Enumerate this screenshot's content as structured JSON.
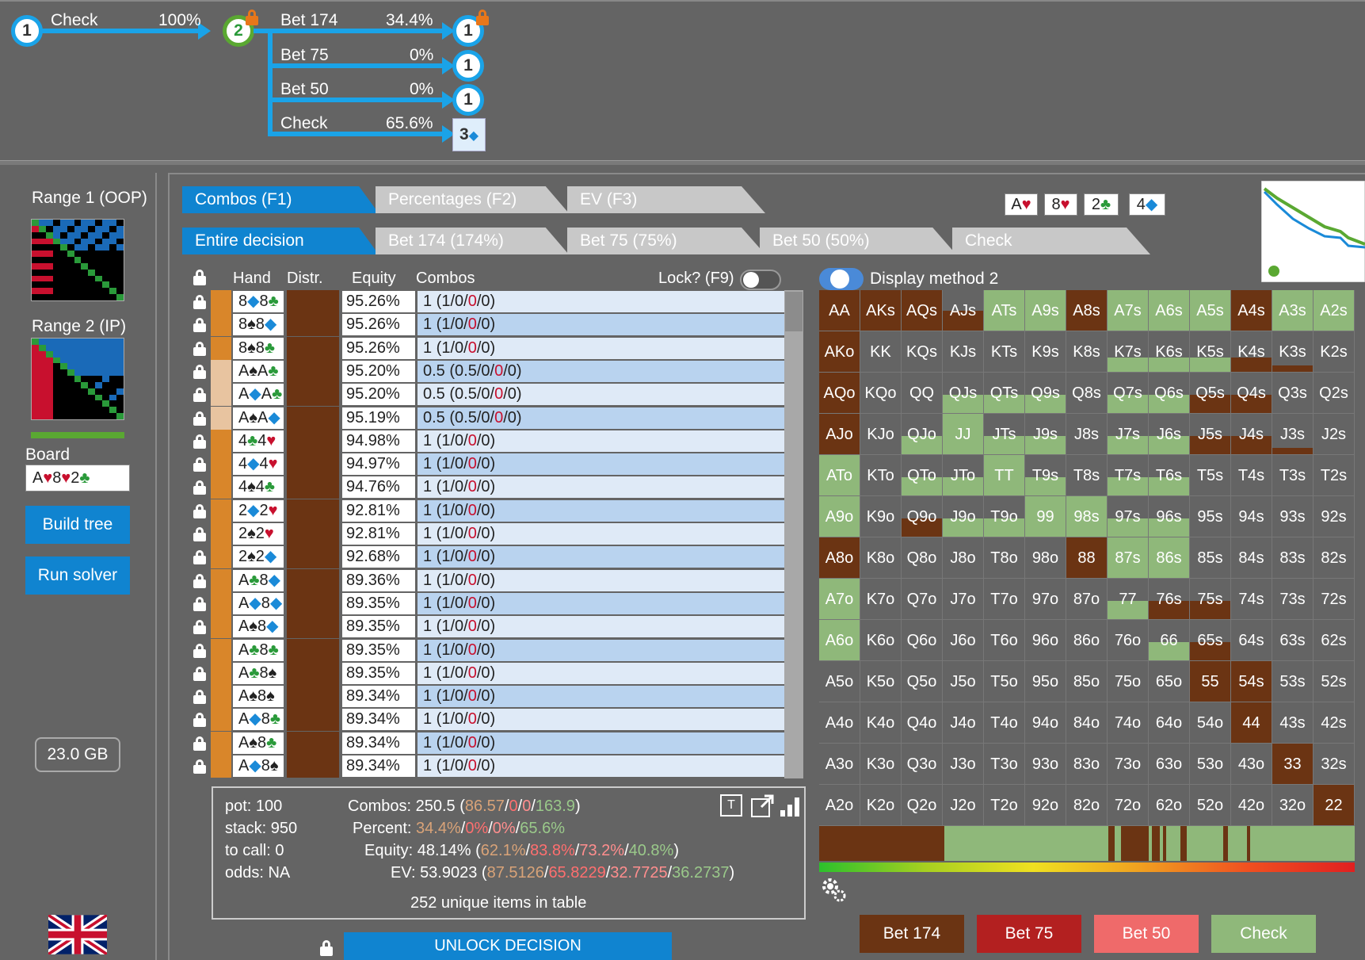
{
  "tree": {
    "root_node": "1",
    "root_action": "Check",
    "root_pct": "100%",
    "node2": "2",
    "branches": [
      {
        "label": "Bet 174",
        "pct": "34.4%",
        "node": "1"
      },
      {
        "label": "Bet 75",
        "pct": "0%",
        "node": "1"
      },
      {
        "label": "Bet 50",
        "pct": "0%",
        "node": "1"
      },
      {
        "label": "Check",
        "pct": "65.6%",
        "node": "3"
      }
    ]
  },
  "left": {
    "range1_title": "Range 1 (OOP)",
    "range2_title": "Range 2 (IP)",
    "board_label": "Board",
    "board_value": [
      "A",
      "♥",
      "8",
      "♥",
      "2",
      "♣"
    ],
    "build_tree": "Build tree",
    "run_solver": "Run solver",
    "memory": "23.0 GB"
  },
  "tabs": {
    "view": [
      "Combos (F1)",
      "Percentages (F2)",
      "EV (F3)"
    ],
    "decision": [
      "Entire decision",
      "Bet 174 (174%)",
      "Bet 75 (75%)",
      "Bet 50 (50%)",
      "Check"
    ]
  },
  "board_cards": [
    {
      "rank": "A",
      "suit": "♥",
      "color": "#c8102e"
    },
    {
      "rank": "8",
      "suit": "♥",
      "color": "#c8102e"
    },
    {
      "rank": "2",
      "suit": "♣",
      "color": "#2a9a3a"
    },
    {
      "rank": "4",
      "suit": "◆",
      "color": "#1a8ad8"
    }
  ],
  "table": {
    "headers": {
      "hand": "Hand",
      "distr": "Distr.",
      "equity": "Equity",
      "combos": "Combos",
      "lock": "Lock? (F9)"
    },
    "display_method": "Display method 2",
    "rows": [
      {
        "r1": "8",
        "s1": "◆",
        "r2": "8",
        "s2": "♣",
        "eq": "95.26%",
        "c0": "1",
        "c1": "1",
        "strip": "#d9862a"
      },
      {
        "r1": "8",
        "s1": "♠",
        "r2": "8",
        "s2": "◆",
        "eq": "95.26%",
        "c0": "1",
        "c1": "1",
        "strip": "#d9862a"
      },
      {
        "r1": "8",
        "s1": "♠",
        "r2": "8",
        "s2": "♣",
        "eq": "95.26%",
        "c0": "1",
        "c1": "1",
        "strip": "#d9862a"
      },
      {
        "r1": "A",
        "s1": "♠",
        "r2": "A",
        "s2": "♣",
        "eq": "95.20%",
        "c0": "0.5",
        "c1": "0.5",
        "strip": "#e8c4a0"
      },
      {
        "r1": "A",
        "s1": "◆",
        "r2": "A",
        "s2": "♣",
        "eq": "95.20%",
        "c0": "0.5",
        "c1": "0.5",
        "strip": "#e8c4a0"
      },
      {
        "r1": "A",
        "s1": "♠",
        "r2": "A",
        "s2": "◆",
        "eq": "95.19%",
        "c0": "0.5",
        "c1": "0.5",
        "strip": "#e8c4a0"
      },
      {
        "r1": "4",
        "s1": "♣",
        "r2": "4",
        "s2": "♥",
        "eq": "94.98%",
        "c0": "1",
        "c1": "1",
        "strip": "#d9862a"
      },
      {
        "r1": "4",
        "s1": "◆",
        "r2": "4",
        "s2": "♥",
        "eq": "94.97%",
        "c0": "1",
        "c1": "1",
        "strip": "#d9862a"
      },
      {
        "r1": "4",
        "s1": "♠",
        "r2": "4",
        "s2": "♣",
        "eq": "94.76%",
        "c0": "1",
        "c1": "1",
        "strip": "#d9862a"
      },
      {
        "r1": "2",
        "s1": "◆",
        "r2": "2",
        "s2": "♥",
        "eq": "92.81%",
        "c0": "1",
        "c1": "1",
        "strip": "#d9862a"
      },
      {
        "r1": "2",
        "s1": "♠",
        "r2": "2",
        "s2": "♥",
        "eq": "92.81%",
        "c0": "1",
        "c1": "1",
        "strip": "#d9862a"
      },
      {
        "r1": "2",
        "s1": "♠",
        "r2": "2",
        "s2": "◆",
        "eq": "92.68%",
        "c0": "1",
        "c1": "1",
        "strip": "#d9862a"
      },
      {
        "r1": "A",
        "s1": "♣",
        "r2": "8",
        "s2": "◆",
        "eq": "89.36%",
        "c0": "1",
        "c1": "1",
        "strip": "#d9862a"
      },
      {
        "r1": "A",
        "s1": "◆",
        "r2": "8",
        "s2": "◆",
        "eq": "89.35%",
        "c0": "1",
        "c1": "1",
        "strip": "#d9862a"
      },
      {
        "r1": "A",
        "s1": "♠",
        "r2": "8",
        "s2": "◆",
        "eq": "89.35%",
        "c0": "1",
        "c1": "1",
        "strip": "#d9862a"
      },
      {
        "r1": "A",
        "s1": "♣",
        "r2": "8",
        "s2": "♣",
        "eq": "89.35%",
        "c0": "1",
        "c1": "1",
        "strip": "#d9862a"
      },
      {
        "r1": "A",
        "s1": "♣",
        "r2": "8",
        "s2": "♠",
        "eq": "89.35%",
        "c0": "1",
        "c1": "1",
        "strip": "#d9862a"
      },
      {
        "r1": "A",
        "s1": "♠",
        "r2": "8",
        "s2": "♠",
        "eq": "89.34%",
        "c0": "1",
        "c1": "1",
        "strip": "#d9862a"
      },
      {
        "r1": "A",
        "s1": "◆",
        "r2": "8",
        "s2": "♣",
        "eq": "89.34%",
        "c0": "1",
        "c1": "1",
        "strip": "#d9862a"
      },
      {
        "r1": "A",
        "s1": "♠",
        "r2": "8",
        "s2": "♣",
        "eq": "89.34%",
        "c0": "1",
        "c1": "1",
        "strip": "#d9862a"
      },
      {
        "r1": "A",
        "s1": "◆",
        "r2": "8",
        "s2": "♠",
        "eq": "89.34%",
        "c0": "1",
        "c1": "1",
        "strip": "#d9862a"
      }
    ]
  },
  "info": {
    "pot": "pot: 100",
    "stack": "stack: 950",
    "to_call": "to call: 0",
    "odds": "odds: NA",
    "combos_label": "Combos:",
    "combos_total": "250.5",
    "combos_parts": [
      "86.57",
      "0",
      "0",
      "163.9"
    ],
    "percent_label": "Percent:",
    "percent_parts": [
      "34.4%",
      "0%",
      "0%",
      "65.6%"
    ],
    "equity_label": "Equity:",
    "equity_total": "48.14%",
    "equity_parts": [
      "62.1%",
      "83.8%",
      "73.2%",
      "40.8%"
    ],
    "ev_label": "EV:",
    "ev_total": "53.9023",
    "ev_parts": [
      "87.5126",
      "65.8229",
      "32.7725",
      "36.2737"
    ],
    "unique": "252 unique items in table"
  },
  "matrix": [
    [
      "AA",
      "AKs",
      "AQs",
      "AJs",
      "ATs",
      "A9s",
      "A8s",
      "A7s",
      "A6s",
      "A5s",
      "A4s",
      "A3s",
      "A2s"
    ],
    [
      "AKo",
      "KK",
      "KQs",
      "KJs",
      "KTs",
      "K9s",
      "K8s",
      "K7s",
      "K6s",
      "K5s",
      "K4s",
      "K3s",
      "K2s"
    ],
    [
      "AQo",
      "KQo",
      "QQ",
      "QJs",
      "QTs",
      "Q9s",
      "Q8s",
      "Q7s",
      "Q6s",
      "Q5s",
      "Q4s",
      "Q3s",
      "Q2s"
    ],
    [
      "AJo",
      "KJo",
      "QJo",
      "JJ",
      "JTs",
      "J9s",
      "J8s",
      "J7s",
      "J6s",
      "J5s",
      "J4s",
      "J3s",
      "J2s"
    ],
    [
      "ATo",
      "KTo",
      "QTo",
      "JTo",
      "TT",
      "T9s",
      "T8s",
      "T7s",
      "T6s",
      "T5s",
      "T4s",
      "T3s",
      "T2s"
    ],
    [
      "A9o",
      "K9o",
      "Q9o",
      "J9o",
      "T9o",
      "99",
      "98s",
      "97s",
      "96s",
      "95s",
      "94s",
      "93s",
      "92s"
    ],
    [
      "A8o",
      "K8o",
      "Q8o",
      "J8o",
      "T8o",
      "98o",
      "88",
      "87s",
      "86s",
      "85s",
      "84s",
      "83s",
      "82s"
    ],
    [
      "A7o",
      "K7o",
      "Q7o",
      "J7o",
      "T7o",
      "97o",
      "87o",
      "77",
      "76s",
      "75s",
      "74s",
      "73s",
      "72s"
    ],
    [
      "A6o",
      "K6o",
      "Q6o",
      "J6o",
      "T6o",
      "96o",
      "86o",
      "76o",
      "66",
      "65s",
      "64s",
      "63s",
      "62s"
    ],
    [
      "A5o",
      "K5o",
      "Q5o",
      "J5o",
      "T5o",
      "95o",
      "85o",
      "75o",
      "65o",
      "55",
      "54s",
      "53s",
      "52s"
    ],
    [
      "A4o",
      "K4o",
      "Q4o",
      "J4o",
      "T4o",
      "94o",
      "84o",
      "74o",
      "64o",
      "54o",
      "44",
      "43s",
      "42s"
    ],
    [
      "A3o",
      "K3o",
      "Q3o",
      "J3o",
      "T3o",
      "93o",
      "83o",
      "73o",
      "63o",
      "53o",
      "43o",
      "33",
      "32s"
    ],
    [
      "A2o",
      "K2o",
      "Q2o",
      "J2o",
      "T2o",
      "92o",
      "82o",
      "72o",
      "62o",
      "52o",
      "42o",
      "32o",
      "22"
    ]
  ],
  "matrix_fill": [
    [
      [
        "b",
        1
      ],
      [
        "b",
        1
      ],
      [
        "b",
        1
      ],
      [
        "b",
        0.5
      ],
      [
        "g",
        1
      ],
      [
        "g",
        1
      ],
      [
        "b",
        1
      ],
      [
        "g",
        1
      ],
      [
        "g",
        1
      ],
      [
        "g",
        1
      ],
      [
        "b",
        1
      ],
      [
        "g",
        1
      ],
      [
        "g",
        1
      ]
    ],
    [
      [
        "b",
        1
      ],
      [
        "n",
        0
      ],
      [
        "n",
        0
      ],
      [
        "n",
        0
      ],
      [
        "n",
        0
      ],
      [
        "n",
        0
      ],
      [
        "n",
        0
      ],
      [
        "g",
        0.35
      ],
      [
        "g",
        0.35
      ],
      [
        "g",
        0.35
      ],
      [
        "b",
        0.35
      ],
      [
        "b",
        0.15
      ],
      [
        "n",
        0
      ]
    ],
    [
      [
        "b",
        1
      ],
      [
        "n",
        0
      ],
      [
        "n",
        0
      ],
      [
        "g",
        0.45
      ],
      [
        "g",
        0.45
      ],
      [
        "g",
        0.45
      ],
      [
        "n",
        0
      ],
      [
        "g",
        0.45
      ],
      [
        "g",
        0.45
      ],
      [
        "b",
        0.45
      ],
      [
        "b",
        0.45
      ],
      [
        "n",
        0
      ],
      [
        "n",
        0
      ]
    ],
    [
      [
        "b",
        1
      ],
      [
        "n",
        0
      ],
      [
        "g",
        0.45
      ],
      [
        "g",
        1
      ],
      [
        "g",
        0.45
      ],
      [
        "g",
        0.45
      ],
      [
        "n",
        0
      ],
      [
        "g",
        0.45
      ],
      [
        "g",
        0.45
      ],
      [
        "b",
        0.45
      ],
      [
        "b",
        0.45
      ],
      [
        "b",
        0.15
      ],
      [
        "n",
        0
      ]
    ],
    [
      [
        "g",
        1
      ],
      [
        "n",
        0
      ],
      [
        "g",
        0.45
      ],
      [
        "g",
        0.45
      ],
      [
        "g",
        1
      ],
      [
        "g",
        0.45
      ],
      [
        "n",
        0
      ],
      [
        "g",
        0.45
      ],
      [
        "g",
        0.45
      ],
      [
        "n",
        0
      ],
      [
        "n",
        0
      ],
      [
        "n",
        0
      ],
      [
        "n",
        0
      ]
    ],
    [
      [
        "g",
        1
      ],
      [
        "n",
        0
      ],
      [
        "b",
        0.45
      ],
      [
        "g",
        0.45
      ],
      [
        "g",
        0.45
      ],
      [
        "g",
        1
      ],
      [
        "g",
        1
      ],
      [
        "g",
        0.45
      ],
      [
        "g",
        0.45
      ],
      [
        "n",
        0
      ],
      [
        "n",
        0
      ],
      [
        "n",
        0
      ],
      [
        "n",
        0
      ]
    ],
    [
      [
        "b",
        1
      ],
      [
        "n",
        0
      ],
      [
        "n",
        0
      ],
      [
        "n",
        0
      ],
      [
        "n",
        0
      ],
      [
        "n",
        0
      ],
      [
        "b",
        1
      ],
      [
        "g",
        1
      ],
      [
        "g",
        1
      ],
      [
        "n",
        0
      ],
      [
        "n",
        0
      ],
      [
        "n",
        0
      ],
      [
        "n",
        0
      ]
    ],
    [
      [
        "g",
        1
      ],
      [
        "n",
        0
      ],
      [
        "n",
        0
      ],
      [
        "n",
        0
      ],
      [
        "n",
        0
      ],
      [
        "n",
        0
      ],
      [
        "n",
        0
      ],
      [
        "g",
        0.45
      ],
      [
        "b",
        0.45
      ],
      [
        "b",
        0.45
      ],
      [
        "n",
        0
      ],
      [
        "n",
        0
      ],
      [
        "n",
        0
      ]
    ],
    [
      [
        "g",
        1
      ],
      [
        "n",
        0
      ],
      [
        "n",
        0
      ],
      [
        "n",
        0
      ],
      [
        "n",
        0
      ],
      [
        "n",
        0
      ],
      [
        "n",
        0
      ],
      [
        "n",
        0
      ],
      [
        "g",
        0.45
      ],
      [
        "b",
        0.45
      ],
      [
        "n",
        0
      ],
      [
        "n",
        0
      ],
      [
        "n",
        0
      ]
    ],
    [
      [
        "n",
        0
      ],
      [
        "n",
        0
      ],
      [
        "n",
        0
      ],
      [
        "n",
        0
      ],
      [
        "n",
        0
      ],
      [
        "n",
        0
      ],
      [
        "n",
        0
      ],
      [
        "n",
        0
      ],
      [
        "n",
        0
      ],
      [
        "b",
        1
      ],
      [
        "b",
        1
      ],
      [
        "n",
        0
      ],
      [
        "n",
        0
      ]
    ],
    [
      [
        "n",
        0
      ],
      [
        "n",
        0
      ],
      [
        "n",
        0
      ],
      [
        "n",
        0
      ],
      [
        "n",
        0
      ],
      [
        "n",
        0
      ],
      [
        "n",
        0
      ],
      [
        "n",
        0
      ],
      [
        "n",
        0
      ],
      [
        "n",
        0
      ],
      [
        "b",
        1
      ],
      [
        "n",
        0
      ],
      [
        "n",
        0
      ]
    ],
    [
      [
        "n",
        0
      ],
      [
        "n",
        0
      ],
      [
        "n",
        0
      ],
      [
        "n",
        0
      ],
      [
        "n",
        0
      ],
      [
        "n",
        0
      ],
      [
        "n",
        0
      ],
      [
        "n",
        0
      ],
      [
        "n",
        0
      ],
      [
        "n",
        0
      ],
      [
        "n",
        0
      ],
      [
        "b",
        1
      ],
      [
        "n",
        0
      ]
    ],
    [
      [
        "n",
        0
      ],
      [
        "n",
        0
      ],
      [
        "n",
        0
      ],
      [
        "n",
        0
      ],
      [
        "n",
        0
      ],
      [
        "n",
        0
      ],
      [
        "n",
        0
      ],
      [
        "n",
        0
      ],
      [
        "n",
        0
      ],
      [
        "n",
        0
      ],
      [
        "n",
        0
      ],
      [
        "n",
        0
      ],
      [
        "b",
        1
      ]
    ]
  ],
  "action_buttons": [
    {
      "label": "Bet 174",
      "color": "#6b3413"
    },
    {
      "label": "Bet 75",
      "color": "#b32020"
    },
    {
      "label": "Bet 50",
      "color": "#ef6a6a"
    },
    {
      "label": "Check",
      "color": "#8fb87a"
    }
  ],
  "unlock": "UNLOCK DECISION",
  "colors": {
    "accent": "#1084d0",
    "bet_big": "#6b3413",
    "check": "#8fb87a"
  }
}
